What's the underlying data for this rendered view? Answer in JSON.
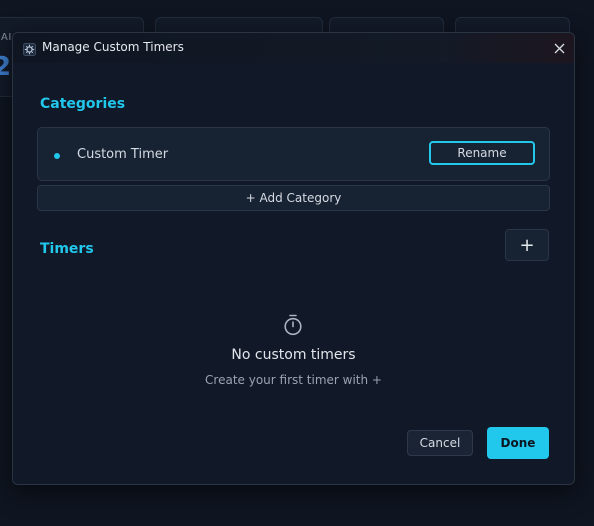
{
  "background": {
    "card_label": "DAI",
    "card_value": "2"
  },
  "dialog": {
    "title": "Manage Custom Timers",
    "close_icon": "close-icon",
    "app_icon": "app-gear-icon"
  },
  "categories": {
    "heading": "Categories",
    "items": [
      {
        "name": "Custom Timer",
        "rename_label": "Rename"
      }
    ],
    "add_label": "+ Add Category"
  },
  "timers": {
    "heading": "Timers",
    "add_label": "+",
    "empty_icon": "stopwatch-icon",
    "empty_title": "No custom timers",
    "empty_subtitle": "Create your first timer with +"
  },
  "footer": {
    "cancel_label": "Cancel",
    "done_label": "Done"
  },
  "colors": {
    "accent": "#22c7ec",
    "background": "#0f1521",
    "dialog": "#111827"
  }
}
